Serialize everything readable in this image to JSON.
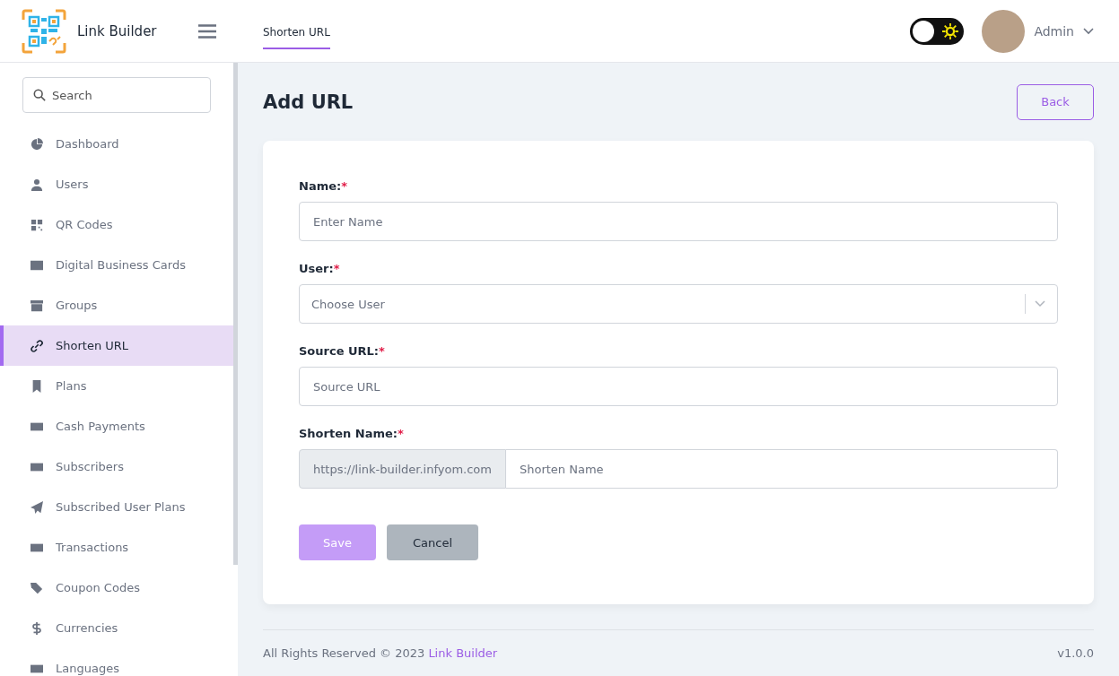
{
  "brand": {
    "name": "Link Builder"
  },
  "header": {
    "tabs": [
      {
        "label": "Shorten URL",
        "selected": true
      }
    ],
    "theme_toggle": {
      "on": false
    },
    "user": {
      "name": "Admin"
    }
  },
  "sidebar": {
    "search": {
      "placeholder": "Search"
    },
    "items": [
      {
        "label": "Dashboard",
        "selected": false
      },
      {
        "label": "Users",
        "selected": false
      },
      {
        "label": "QR Codes",
        "selected": false
      },
      {
        "label": "Digital Business Cards",
        "selected": false
      },
      {
        "label": "Groups",
        "selected": false
      },
      {
        "label": "Shorten URL",
        "selected": true
      },
      {
        "label": "Plans",
        "selected": false
      },
      {
        "label": "Cash Payments",
        "selected": false
      },
      {
        "label": "Subscribers",
        "selected": false
      },
      {
        "label": "Subscribed User Plans",
        "selected": false
      },
      {
        "label": "Transactions",
        "selected": false
      },
      {
        "label": "Coupon Codes",
        "selected": false
      },
      {
        "label": "Currencies",
        "selected": false
      },
      {
        "label": "Languages",
        "selected": false
      }
    ]
  },
  "page": {
    "title": "Add URL",
    "back_button": "Back"
  },
  "form": {
    "fields": [
      {
        "kind": "text",
        "label": "Name:",
        "mark": "*",
        "placeholder": "Enter Name"
      },
      {
        "kind": "select",
        "label": "User:",
        "mark": "*",
        "placeholder": "Choose User"
      },
      {
        "kind": "text",
        "label": "Source URL:",
        "mark": "*",
        "placeholder": "Source URL"
      },
      {
        "kind": "prefixed",
        "label": "Shorten Name:",
        "mark": "*",
        "prefix": "https://link-builder.infyom.com",
        "placeholder": "Shorten Name"
      }
    ],
    "buttons": [
      {
        "kind": "primary",
        "label": "Save",
        "disabled": true
      },
      {
        "kind": "secondary",
        "label": "Cancel",
        "disabled": false
      }
    ]
  },
  "footer": {
    "copyright": "All Rights Reserved © 2023",
    "link": "Link Builder",
    "version": "v1.0.0"
  }
}
